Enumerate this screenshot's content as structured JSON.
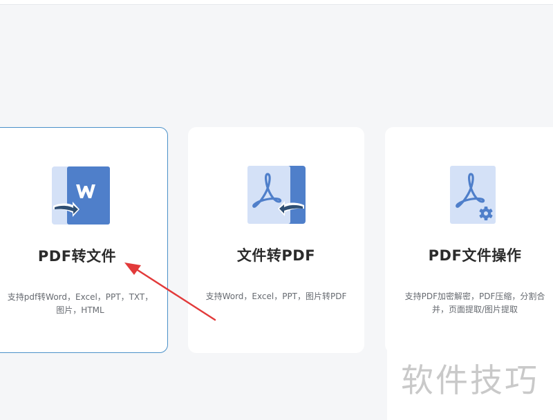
{
  "cards": [
    {
      "title": "PDF转文件",
      "description": "支持pdf转Word，Excel，PPT，TXT，图片，HTML",
      "icon": "pdf-to-word-icon",
      "selected": true
    },
    {
      "title": "文件转PDF",
      "description": "支持Word，Excel，PPT，图片转PDF",
      "icon": "file-to-pdf-icon",
      "selected": false
    },
    {
      "title": "PDF文件操作",
      "description": "支持PDF加密解密，PDF压缩，分割合并，页面提取/图片提取",
      "icon": "pdf-settings-icon",
      "selected": false
    }
  ],
  "watermark": "软件技巧",
  "colors": {
    "accent": "#4a90c8",
    "icon_dark": "#4f7fca",
    "icon_light": "#d4e1f7",
    "arrow_annotation": "#e23a3a"
  }
}
